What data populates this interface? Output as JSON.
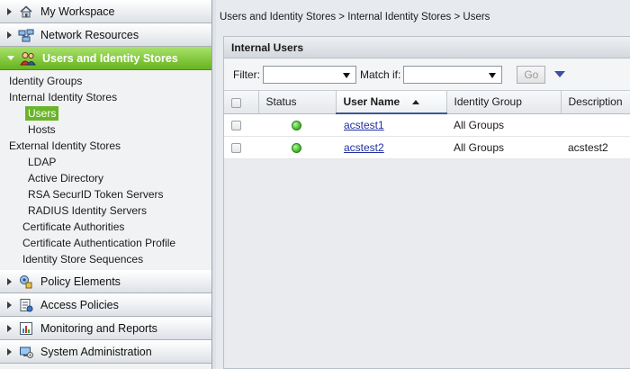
{
  "colors": {
    "accent_green": "#6ab42a",
    "status_ok": "#42c02e",
    "link": "#1f2fa0"
  },
  "nav": {
    "top_sections": [
      {
        "label": "My Workspace",
        "icon": "house-icon"
      },
      {
        "label": "Network Resources",
        "icon": "network-icon"
      },
      {
        "label": "Users and Identity Stores",
        "icon": "users-icon",
        "active": true
      }
    ],
    "tree": {
      "identity_groups": "Identity Groups",
      "internal_identity_stores": "Internal Identity Stores",
      "users": "Users",
      "hosts": "Hosts",
      "external_identity_stores": "External Identity Stores",
      "ldap": "LDAP",
      "active_directory": "Active Directory",
      "rsa_securid": "RSA SecurID Token Servers",
      "radius_identity_servers": "RADIUS Identity Servers",
      "certificate_authorities": "Certificate Authorities",
      "certificate_authentication_profile": "Certificate Authentication Profile",
      "identity_store_sequences": "Identity Store Sequences"
    },
    "bottom_sections": [
      {
        "label": "Policy Elements",
        "icon": "policy-elements-icon"
      },
      {
        "label": "Access Policies",
        "icon": "access-policies-icon"
      },
      {
        "label": "Monitoring and Reports",
        "icon": "monitoring-icon"
      },
      {
        "label": "System Administration",
        "icon": "system-admin-icon"
      }
    ]
  },
  "main": {
    "breadcrumb": "Users and Identity Stores > Internal Identity Stores > Users",
    "panel_title": "Internal Users",
    "filter": {
      "filter_label": "Filter:",
      "filter_value": "",
      "match_label": "Match if:",
      "match_value": "",
      "go_label": "Go"
    },
    "table": {
      "columns": [
        "Status",
        "User Name",
        "Identity Group",
        "Description"
      ],
      "sorted_column": "User Name",
      "rows": [
        {
          "status": "enabled",
          "user_name": "acstest1",
          "identity_group": "All Groups",
          "description": ""
        },
        {
          "status": "enabled",
          "user_name": "acstest2",
          "identity_group": "All Groups",
          "description": "acstest2"
        }
      ]
    }
  }
}
